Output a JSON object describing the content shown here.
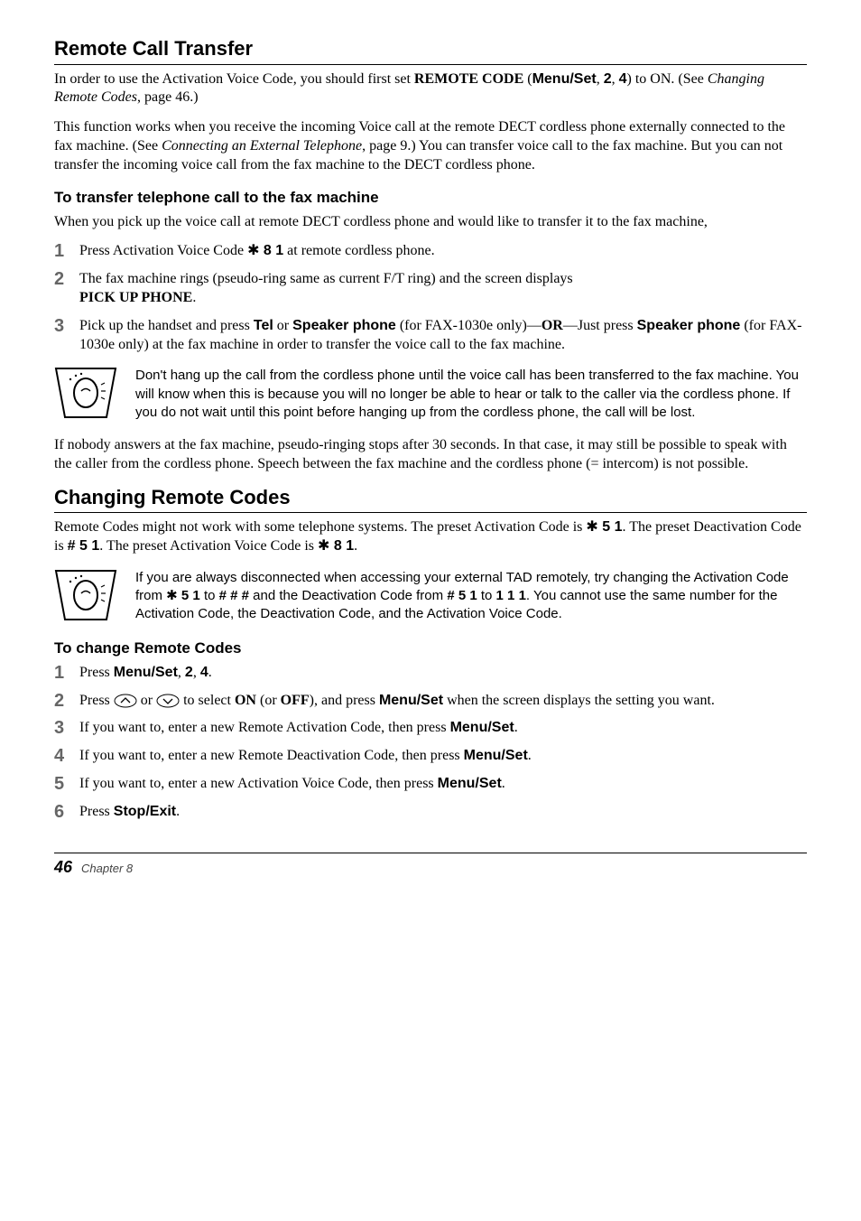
{
  "section1": {
    "heading": "Remote Call Transfer",
    "para1_a": "In order to use the Activation Voice Code, you should first set ",
    "para1_b": "REMOTE CODE",
    "para1_c": " (",
    "para1_d": "Menu/Set",
    "para1_e": ", ",
    "para1_f": "2",
    "para1_g": ", ",
    "para1_h": "4",
    "para1_i": ") to ON. (See ",
    "para1_j": "Changing Remote Codes",
    "para1_k": ", page 46.)",
    "para2_a": "This function works when you receive the incoming Voice call at the remote DECT cordless phone externally connected to the fax machine. (See ",
    "para2_b": "Connecting an External Telephone",
    "para2_c": ", page 9.) You can transfer voice call to the fax machine. But you can not transfer the incoming voice call from the fax machine to the DECT cordless phone.",
    "subhead1": "To transfer telephone call to the fax machine",
    "intro1": "When you pick up the voice call at remote DECT cordless phone and would like to transfer it to the fax machine,",
    "steps1": {
      "s1_a": "Press Activation Voice Code ",
      "s1_b": " 8 1",
      "s1_c": " at remote cordless phone.",
      "s2_a": "The fax machine rings (pseudo-ring same as current F/T ring) and the screen displays ",
      "s2_b": "PICK UP PHONE",
      "s2_c": ".",
      "s3_a": "Pick up the handset and press ",
      "s3_b": "Tel",
      "s3_c": " or ",
      "s3_d": "Speaker phone",
      "s3_e": " (for FAX-1030e only)—",
      "s3_f": "OR",
      "s3_g": "—Just press ",
      "s3_h": "Speaker phone",
      "s3_i": " (for FAX-1030e only) at the fax machine in order to transfer the voice call to the fax machine."
    },
    "note1": "Don't hang up the call from the cordless phone until the voice call has been transferred to the fax machine. You will know when this is because you will no longer be able to hear or talk to the caller via the cordless phone. If you do not wait until this point before hanging up from the cordless phone, the call will be lost.",
    "para3": "If nobody answers at the fax machine, pseudo-ringing stops after 30 seconds. In that case, it may still be possible to speak with the caller from the cordless phone. Speech between the fax machine and the cordless phone (= intercom) is not possible."
  },
  "section2": {
    "heading": "Changing Remote Codes",
    "para1_a": "Remote Codes might not work with some telephone systems. The preset Activation Code is ",
    "para1_b": " 5 1",
    "para1_c": ". The preset Deactivation Code is ",
    "para1_d": "# 5 1",
    "para1_e": ". The preset Activation Voice Code is ",
    "para1_f": " 8 1",
    "para1_g": ".",
    "note_a": "If you are always disconnected when accessing your external TAD remotely, try changing the Activation Code from ",
    "note_b": " 5 1",
    "note_c": " to ",
    "note_d": "# # #",
    "note_e": " and the Deactivation Code from ",
    "note_f": "# 5 1",
    "note_g": " to ",
    "note_h": "1 1 1",
    "note_i": ". You cannot use the same number for the Activation Code, the Deactivation Code, and the Activation Voice Code.",
    "subhead2": "To change Remote Codes",
    "steps2": {
      "s1_a": "Press ",
      "s1_b": "Menu/Set",
      "s1_c": ", ",
      "s1_d": "2",
      "s1_e": ", ",
      "s1_f": "4",
      "s1_g": ".",
      "s2_a": "Press ",
      "s2_b": " or ",
      "s2_c": " to select ",
      "s2_d": "ON",
      "s2_e": " (or ",
      "s2_f": "OFF",
      "s2_g": "), and press ",
      "s2_h": "Menu/Set",
      "s2_i": " when the screen displays the setting you want.",
      "s3_a": "If you want to, enter a new Remote Activation Code, then press ",
      "s3_b": "Menu/Set",
      "s3_c": ".",
      "s4_a": "If you want to, enter a new Remote Deactivation Code, then press ",
      "s4_b": "Menu/Set",
      "s4_c": ".",
      "s5_a": "If you want to, enter a new Activation Voice Code, then press ",
      "s5_b": "Menu/Set",
      "s5_c": ".",
      "s6_a": "Press ",
      "s6_b": "Stop/Exit",
      "s6_c": "."
    }
  },
  "glyphs": {
    "star": "✱"
  },
  "footer": {
    "page": "46",
    "chapter": "Chapter 8"
  }
}
